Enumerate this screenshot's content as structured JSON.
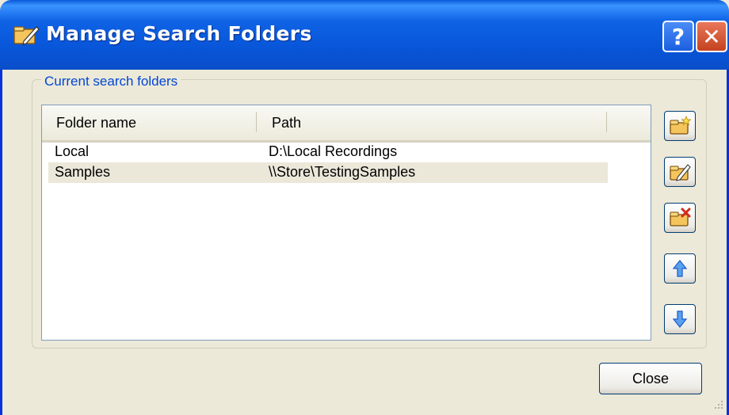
{
  "window": {
    "title": "Manage Search Folders",
    "help_symbol": "?",
    "close_symbol": "✕"
  },
  "group": {
    "label": "Current search folders"
  },
  "list": {
    "columns": [
      "Folder name",
      "Path"
    ],
    "rows": [
      {
        "name": "Local",
        "path": "D:\\Local Recordings",
        "selected": false
      },
      {
        "name": "Samples",
        "path": "\\\\Store\\TestingSamples",
        "selected": true
      }
    ]
  },
  "side_buttons": [
    {
      "icon": "add-folder-icon"
    },
    {
      "icon": "edit-folder-icon"
    },
    {
      "icon": "delete-folder-icon"
    },
    {
      "icon": "arrow-up-icon"
    },
    {
      "icon": "arrow-down-icon"
    }
  ],
  "footer": {
    "close_label": "Close"
  }
}
